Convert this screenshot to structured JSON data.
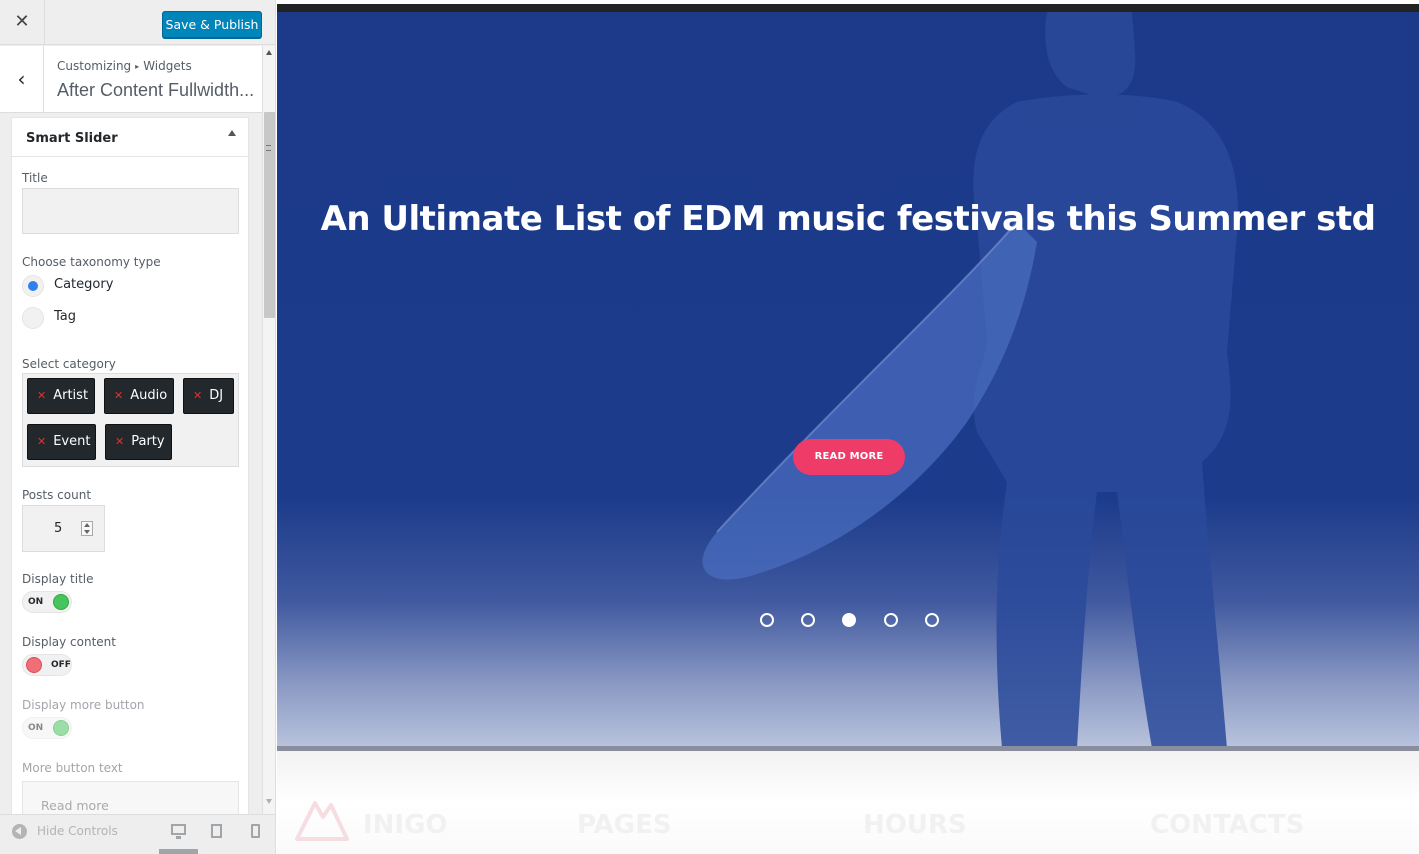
{
  "topbar": {
    "close_icon": "close-icon",
    "publish_label": "Save & Publish"
  },
  "section": {
    "breadcrumb_root": "Customizing",
    "breadcrumb_child": "Widgets",
    "title": "After Content Fullwidth..."
  },
  "widget": {
    "name": "Smart Slider",
    "title_label": "Title",
    "title_value": "",
    "taxonomy_label": "Choose taxonomy type",
    "taxonomy_options": [
      {
        "label": "Category",
        "selected": true
      },
      {
        "label": "Tag",
        "selected": false
      }
    ],
    "category_label": "Select category",
    "categories": [
      "Artist",
      "Audio",
      "DJ",
      "Event",
      "Party"
    ],
    "posts_count_label": "Posts count",
    "posts_count": "5",
    "display_title_label": "Display title",
    "display_title_state": "ON",
    "display_content_label": "Display content",
    "display_content_state": "OFF",
    "display_more_label": "Display more button",
    "display_more_state": "ON",
    "more_text_label": "More button text",
    "more_text_placeholder": "Read more"
  },
  "footer_controls": {
    "hide_label": "Hide Controls",
    "devices": [
      "desktop",
      "tablet",
      "mobile"
    ],
    "active_device": "desktop"
  },
  "preview": {
    "headline": "An Ultimate List of EDM music festivals this Summer std",
    "button_label": "READ MORE",
    "slider_dots": 5,
    "active_dot": 3,
    "footer_headings": [
      "INIGO",
      "PAGES",
      "HOURS",
      "CONTACTS"
    ]
  },
  "colors": {
    "accent": "#0085ba",
    "hero_blue": "#1c3b8b",
    "cta_pink": "#ef3b67",
    "radio_selected": "#2f80ed",
    "toggle_on": "#46c55f",
    "toggle_off": "#ef6f77",
    "tag_bg": "#23282d",
    "tag_remove": "#dc3232"
  }
}
